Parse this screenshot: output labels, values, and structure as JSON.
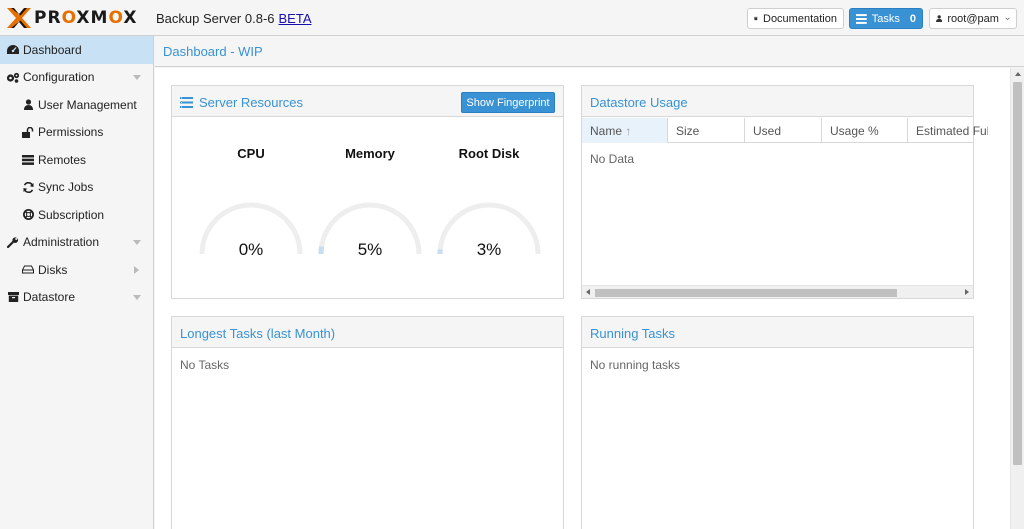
{
  "header": {
    "logo_prefix": "PR",
    "logo_o1": "O",
    "logo_mid": "XM",
    "logo_o2": "O",
    "logo_suffix": "X",
    "version": "Backup Server 0.8-6",
    "beta_label": "BETA",
    "documentation_label": "Documentation",
    "tasks_label": "Tasks",
    "tasks_count": "0",
    "user_label": "root@pam"
  },
  "sidebar": {
    "items": [
      {
        "label": "Dashboard",
        "icon": "dashboard-icon"
      },
      {
        "label": "Configuration",
        "icon": "gears-icon"
      },
      {
        "label": "User Management",
        "icon": "user-icon"
      },
      {
        "label": "Permissions",
        "icon": "unlock-icon"
      },
      {
        "label": "Remotes",
        "icon": "server-icon"
      },
      {
        "label": "Sync Jobs",
        "icon": "refresh-icon"
      },
      {
        "label": "Subscription",
        "icon": "support-icon"
      },
      {
        "label": "Administration",
        "icon": "wrench-icon"
      },
      {
        "label": "Disks",
        "icon": "hdd-icon"
      },
      {
        "label": "Datastore",
        "icon": "archive-icon"
      }
    ]
  },
  "content": {
    "title": "Dashboard - WIP"
  },
  "server_resources": {
    "title": "Server Resources",
    "fingerprint_button": "Show Fingerprint",
    "gauges": [
      {
        "label": "CPU",
        "value": "0%",
        "fraction": 0.0
      },
      {
        "label": "Memory",
        "value": "5%",
        "fraction": 0.05
      },
      {
        "label": "Root Disk",
        "value": "3%",
        "fraction": 0.03
      }
    ]
  },
  "datastore_usage": {
    "title": "Datastore Usage",
    "columns": [
      "Name",
      "Size",
      "Used",
      "Usage %",
      "Estimated Full"
    ],
    "sort_indicator": "↑",
    "empty_text": "No Data"
  },
  "longest_tasks": {
    "title": "Longest Tasks (last Month)",
    "empty_text": "No Tasks"
  },
  "running_tasks": {
    "title": "Running Tasks",
    "empty_text": "No running tasks"
  },
  "colors": {
    "accent": "#3892d4",
    "brand_orange": "#e57000",
    "active_nav": "#c8e1f5",
    "gauge_track": "#eeeeee",
    "gauge_fill": "#c5def2"
  }
}
